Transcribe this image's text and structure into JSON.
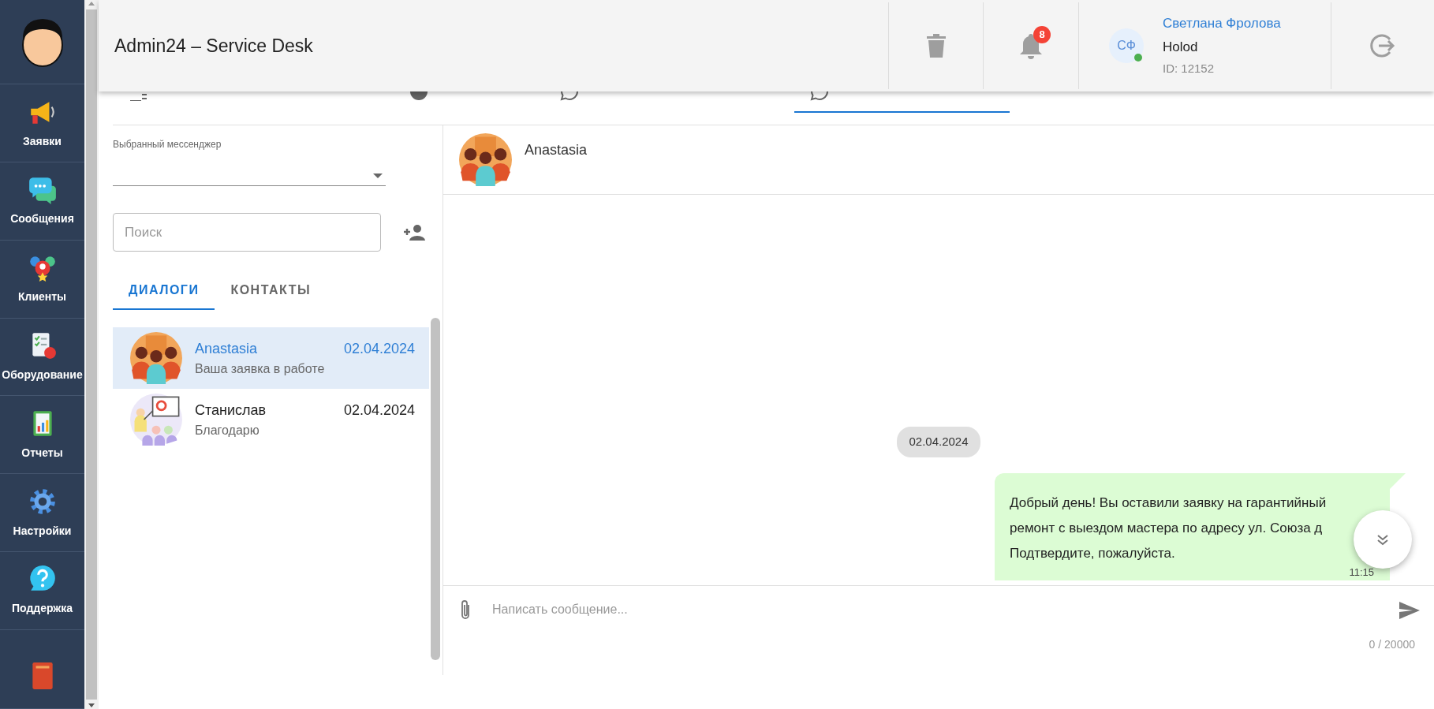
{
  "header": {
    "title": "Admin24 – Service Desk",
    "notifications": {
      "count": "8"
    },
    "user": {
      "initials": "СФ",
      "online": true,
      "name": "Светлана Фролова",
      "company": "Holod",
      "id": "ID: 12152"
    }
  },
  "sidebar": {
    "items": [
      {
        "kind": "labeled",
        "label": "Заявки"
      },
      {
        "kind": "labeled",
        "label": "Сообщения"
      },
      {
        "kind": "labeled",
        "label": "Клиенты"
      },
      {
        "kind": "labeled",
        "label": "Оборудование"
      },
      {
        "kind": "labeled",
        "label": "Отчеты"
      },
      {
        "kind": "labeled",
        "label": "Настройки"
      },
      {
        "kind": "labeled",
        "label": "Поддержка"
      },
      {
        "kind": "icon-only"
      }
    ]
  },
  "channel_tabs": [
    {
      "selected": false
    },
    {
      "selected": false
    },
    {
      "selected": false
    },
    {
      "selected": true
    }
  ],
  "messenger_select": {
    "label": "Выбранный мессенджер"
  },
  "search": {
    "placeholder": "Поиск"
  },
  "list_tabs": [
    {
      "label": "ДИАЛОГИ",
      "selected": true
    },
    {
      "label": "КОНТАКТЫ",
      "selected": false
    }
  ],
  "dialogs": [
    {
      "name": "Anastasia",
      "date": "02.04.2024",
      "preview": "Ваша заявка в работе",
      "selected": true
    },
    {
      "name": "Станислав",
      "date": "02.04.2024",
      "preview": "Благодарю",
      "selected": false
    }
  ],
  "chat": {
    "contact": {
      "name": "Anastasia"
    },
    "messages": [
      {
        "kind": "date",
        "text": "02.04.2024"
      },
      {
        "kind": "outgoing",
        "lines": [
          "Добрый день! Вы оставили заявку на гарантийный",
          "ремонт с выездом мастера по адресу ул. Союза д",
          "Подтвердите, пожалуйста."
        ],
        "time": "11:15"
      }
    ],
    "composer": {
      "placeholder": "Написать сообщение...",
      "counter": "0 / 20000"
    }
  }
}
